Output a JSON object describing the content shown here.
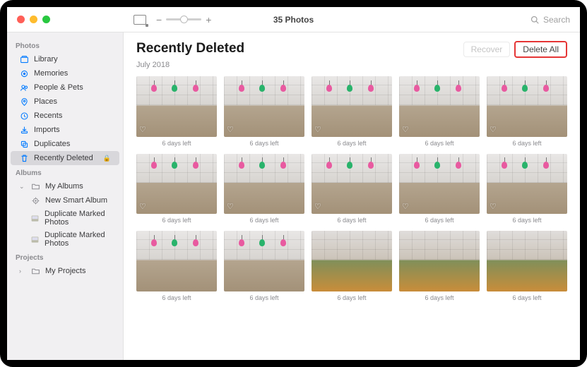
{
  "title_count": "35 Photos",
  "search_placeholder": "Search",
  "sidebar": {
    "sections": [
      {
        "header": "Photos",
        "items": [
          {
            "icon": "library",
            "label": "Library"
          },
          {
            "icon": "memories",
            "label": "Memories"
          },
          {
            "icon": "people",
            "label": "People & Pets"
          },
          {
            "icon": "places",
            "label": "Places"
          },
          {
            "icon": "recents",
            "label": "Recents"
          },
          {
            "icon": "imports",
            "label": "Imports"
          },
          {
            "icon": "duplicates",
            "label": "Duplicates"
          },
          {
            "icon": "trash",
            "label": "Recently Deleted",
            "selected": true,
            "locked": true
          }
        ]
      },
      {
        "header": "Albums",
        "items": [
          {
            "icon": "folder",
            "label": "My Albums",
            "disclosure": "open",
            "children": [
              {
                "icon": "smart",
                "label": "New Smart Album"
              },
              {
                "icon": "album",
                "label": "Duplicate Marked Photos"
              },
              {
                "icon": "album",
                "label": "Duplicate Marked Photos"
              }
            ]
          }
        ]
      },
      {
        "header": "Projects",
        "items": [
          {
            "icon": "folder",
            "label": "My Projects",
            "disclosure": "closed"
          }
        ]
      }
    ]
  },
  "page": {
    "title": "Recently Deleted",
    "date": "July 2018",
    "recover_label": "Recover",
    "delete_all_label": "Delete All"
  },
  "photos": [
    {
      "style": "office",
      "caption": "6 days left",
      "heart": true
    },
    {
      "style": "office",
      "caption": "6 days left",
      "heart": true
    },
    {
      "style": "office",
      "caption": "6 days left",
      "heart": true
    },
    {
      "style": "office",
      "caption": "6 days left",
      "heart": true
    },
    {
      "style": "office",
      "caption": "6 days left",
      "heart": true
    },
    {
      "style": "office",
      "caption": "6 days left",
      "heart": true
    },
    {
      "style": "office",
      "caption": "6 days left",
      "heart": true
    },
    {
      "style": "office",
      "caption": "6 days left",
      "heart": true
    },
    {
      "style": "office",
      "caption": "6 days left",
      "heart": true
    },
    {
      "style": "office",
      "caption": "6 days left",
      "heart": true
    },
    {
      "style": "office",
      "caption": "6 days left",
      "heart": false
    },
    {
      "style": "office",
      "caption": "6 days left",
      "heart": false
    },
    {
      "style": "office2",
      "caption": "6 days left",
      "heart": false
    },
    {
      "style": "office2",
      "caption": "6 days left",
      "heart": false
    },
    {
      "style": "office2",
      "caption": "6 days left",
      "heart": false
    }
  ]
}
